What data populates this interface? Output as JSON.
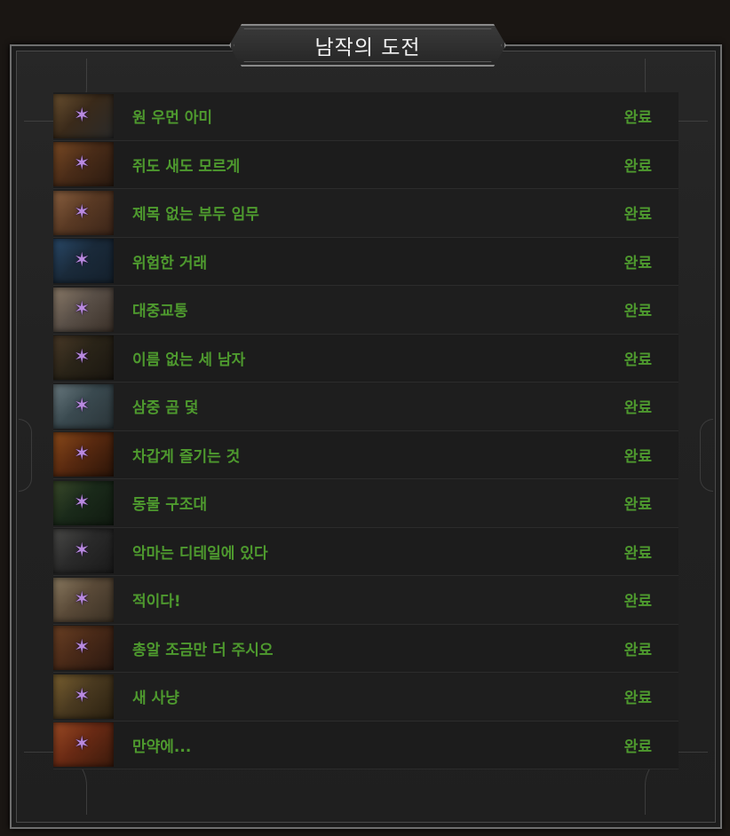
{
  "header": {
    "title": "남작의 도전"
  },
  "status_color": "#4e9a2e",
  "star_icon": "purple-star-icon",
  "challenges": [
    {
      "name": "원 우먼 아미",
      "status": "완료",
      "thumb": [
        "#3a2a1a",
        "#6a5030",
        "#2a2a2a"
      ]
    },
    {
      "name": "쥐도 새도 모르게",
      "status": "완료",
      "thumb": [
        "#4a2c18",
        "#7a4a24",
        "#2a1a10"
      ]
    },
    {
      "name": "제목 없는 부두 임무",
      "status": "완료",
      "thumb": [
        "#5a3a24",
        "#8a6040",
        "#3a2418"
      ]
    },
    {
      "name": "위험한 거래",
      "status": "완료",
      "thumb": [
        "#1a2a3a",
        "#2a4a6a",
        "#14202c"
      ]
    },
    {
      "name": "대중교통",
      "status": "완료",
      "thumb": [
        "#5a5048",
        "#8a7a68",
        "#3a3028"
      ]
    },
    {
      "name": "이름 없는 세 남자",
      "status": "완료",
      "thumb": [
        "#2a2418",
        "#4a3a28",
        "#1a1610"
      ]
    },
    {
      "name": "삼중 곰 덫",
      "status": "완료",
      "thumb": [
        "#3a4a50",
        "#6a7a80",
        "#2a3438"
      ]
    },
    {
      "name": "차갑게 즐기는 것",
      "status": "완료",
      "thumb": [
        "#5a2a10",
        "#8a4a1a",
        "#2a1408"
      ]
    },
    {
      "name": "동물 구조대",
      "status": "완료",
      "thumb": [
        "#1a2a1a",
        "#3a4a2a",
        "#101a10"
      ]
    },
    {
      "name": "악마는 디테일에 있다",
      "status": "완료",
      "thumb": [
        "#2a2a2a",
        "#4a4a48",
        "#1a1a1a"
      ]
    },
    {
      "name": "적이다!",
      "status": "완료",
      "thumb": [
        "#5a4a38",
        "#8a7a60",
        "#3a3024"
      ]
    },
    {
      "name": "총알 조금만 더 주시오",
      "status": "완료",
      "thumb": [
        "#4a2a18",
        "#6a4024",
        "#2a1810"
      ]
    },
    {
      "name": "새 사냥",
      "status": "완료",
      "thumb": [
        "#4a3a20",
        "#7a6030",
        "#2a2010"
      ]
    },
    {
      "name": "만약에...",
      "status": "완료",
      "thumb": [
        "#6a2a14",
        "#9a4a24",
        "#3a1a0c"
      ]
    }
  ]
}
